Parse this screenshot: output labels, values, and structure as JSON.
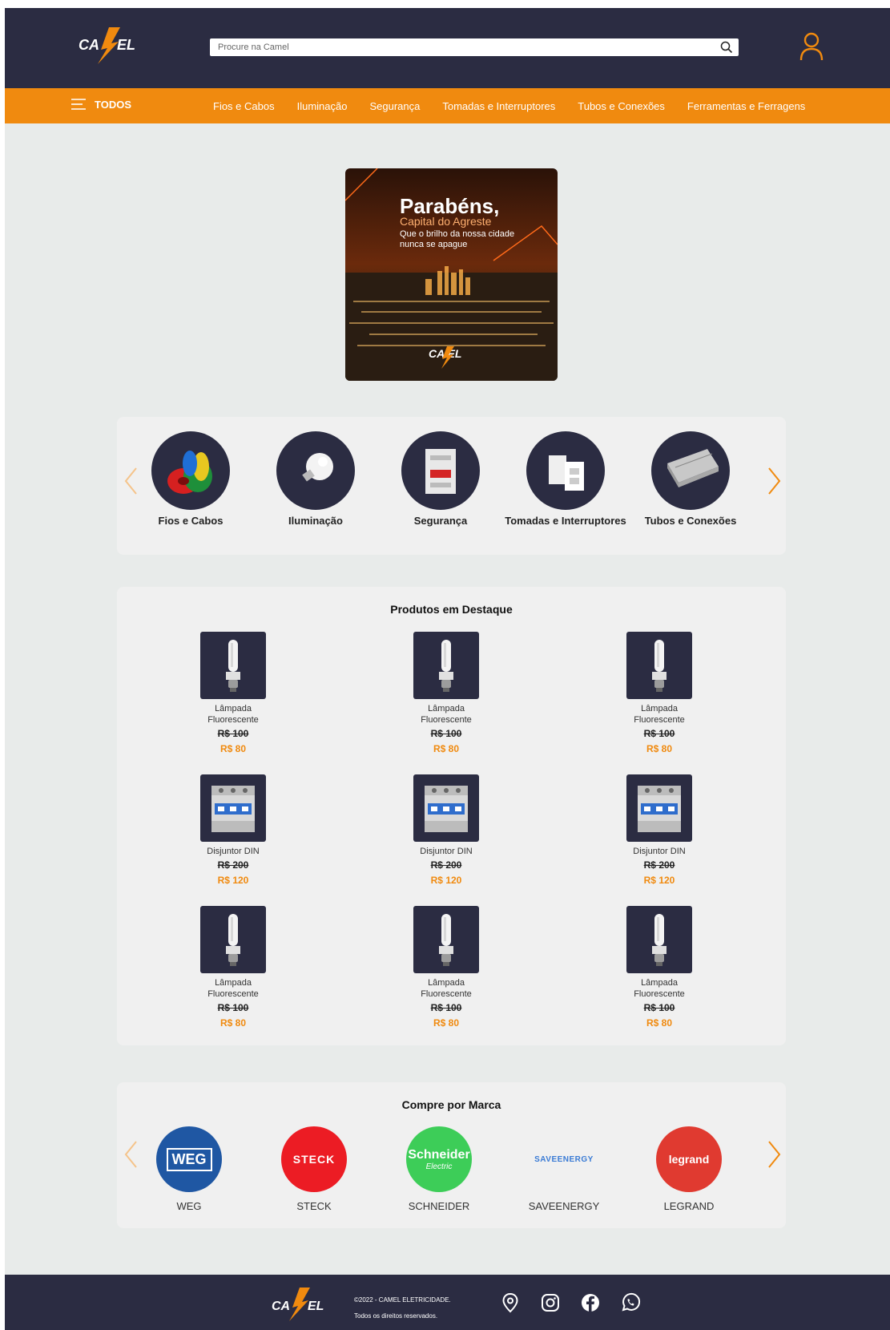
{
  "header": {
    "logo_text": "CAMEL",
    "search_placeholder": "Procure na Camel"
  },
  "nav": {
    "menu_label": "TODOS",
    "links": [
      "Fios e Cabos",
      "Iluminação",
      "Segurança",
      "Tomadas e Interruptores",
      "Tubos e Conexões",
      "Ferramentas e Ferragens"
    ]
  },
  "banner": {
    "title": "Parabéns,",
    "subtitle": "Capital do Agreste",
    "text": "Que o brilho da nossa cidade nunca se apague"
  },
  "categories": [
    {
      "label": "Fios e Cabos",
      "icon": "cables-icon"
    },
    {
      "label": "Iluminação",
      "icon": "bulb-icon"
    },
    {
      "label": "Segurança",
      "icon": "breaker-icon"
    },
    {
      "label": "Tomadas e Interruptores",
      "icon": "socket-icon"
    },
    {
      "label": "Tubos e Conexões",
      "icon": "conduit-icon"
    }
  ],
  "featured": {
    "title": "Produtos em Destaque",
    "products": [
      {
        "name": "Lâmpada Fluorescente",
        "old_price": "R$ 100",
        "new_price": "R$ 80",
        "icon": "lamp-icon"
      },
      {
        "name": "Lâmpada Fluorescente",
        "old_price": "R$ 100",
        "new_price": "R$ 80",
        "icon": "lamp-icon"
      },
      {
        "name": "Lâmpada Fluorescente",
        "old_price": "R$ 100",
        "new_price": "R$ 80",
        "icon": "lamp-icon"
      },
      {
        "name": "Disjuntor DIN",
        "old_price": "R$ 200",
        "new_price": "R$ 120",
        "icon": "breaker-icon"
      },
      {
        "name": "Disjuntor DIN",
        "old_price": "R$ 200",
        "new_price": "R$ 120",
        "icon": "breaker-icon"
      },
      {
        "name": "Disjuntor DIN",
        "old_price": "R$ 200",
        "new_price": "R$ 120",
        "icon": "breaker-icon"
      },
      {
        "name": "Lâmpada Fluorescente",
        "old_price": "R$ 100",
        "new_price": "R$ 80",
        "icon": "lamp-icon"
      },
      {
        "name": "Lâmpada Fluorescente",
        "old_price": "R$ 100",
        "new_price": "R$ 80",
        "icon": "lamp-icon"
      },
      {
        "name": "Lâmpada Fluorescente",
        "old_price": "R$ 100",
        "new_price": "R$ 80",
        "icon": "lamp-icon"
      }
    ]
  },
  "brands": {
    "title": "Compre por Marca",
    "items": [
      {
        "label": "WEG",
        "logo_text": "WEG",
        "color": "#1f57a3"
      },
      {
        "label": "STECK",
        "logo_text": "STECK",
        "color": "#ec1c24"
      },
      {
        "label": "SCHNEIDER",
        "logo_text": "Schneider",
        "logo_sub": "Electric",
        "color": "#3dcd58"
      },
      {
        "label": "SAVEENERGY",
        "logo_text": "SAVEENERGY",
        "color": "#f0f0f0"
      },
      {
        "label": "LEGRAND",
        "logo_text": "legrand",
        "color": "#e03a30"
      }
    ]
  },
  "footer": {
    "copyright": "©2022 - CAMEL ELETRICIDADE.",
    "rights": "Todos os direitos reservados."
  },
  "colors": {
    "dark": "#2b2c42",
    "accent": "#f08a0f",
    "background": "#e8ebea"
  }
}
